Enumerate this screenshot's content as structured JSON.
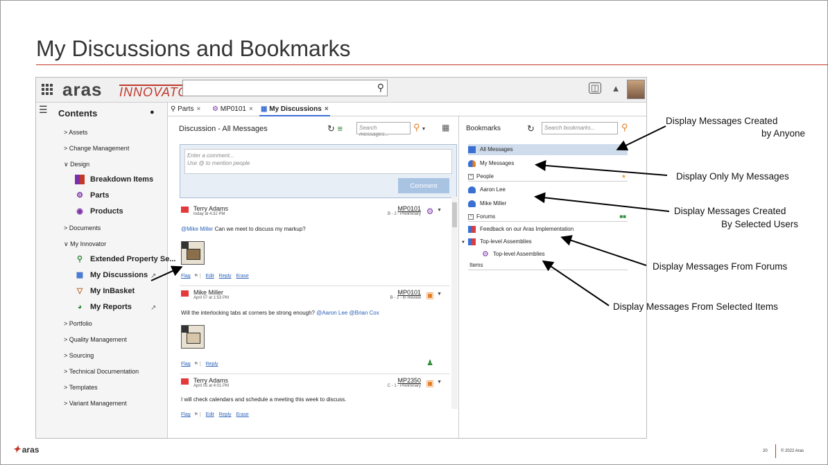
{
  "slide": {
    "title": "My Discussions and Bookmarks",
    "footer_brand": "aras",
    "page_number": "20",
    "copyright": "© 2022 Aras"
  },
  "app": {
    "logo_main": "aras",
    "logo_sub": "INNOVATOR",
    "tabs": [
      {
        "label": "Parts",
        "icon": "search-icon"
      },
      {
        "label": "MP0101",
        "icon": "gear-part-icon"
      },
      {
        "label": "My Discussions",
        "icon": "discussion-icon"
      }
    ],
    "close_glyph": "×"
  },
  "sidebar": {
    "title": "Contents",
    "items": [
      {
        "label": "> Assets"
      },
      {
        "label": "> Change Management"
      },
      {
        "label": "∨ Design"
      },
      {
        "label": "Breakdown Items",
        "icon": "breakdown-icon",
        "sub": true
      },
      {
        "label": "Parts",
        "icon": "parts-icon",
        "sub": true
      },
      {
        "label": "Products",
        "icon": "products-icon",
        "sub": true
      },
      {
        "label": "> Documents"
      },
      {
        "label": "∨ My Innovator"
      },
      {
        "label": "Extended Property Se...",
        "icon": "extended-property-icon",
        "sub": true
      },
      {
        "label": "My Discussions",
        "icon": "discussion-icon",
        "sub": true
      },
      {
        "label": "My InBasket",
        "icon": "inbasket-icon",
        "sub": true
      },
      {
        "label": "My Reports",
        "icon": "reports-icon",
        "sub": true
      },
      {
        "label": "> Portfolio"
      },
      {
        "label": "> Quality Management"
      },
      {
        "label": "> Sourcing"
      },
      {
        "label": "> Technical Documentation"
      },
      {
        "label": "> Templates"
      },
      {
        "label": "> Variant Management"
      }
    ]
  },
  "discussion": {
    "title": "Discussion - All Messages",
    "search_placeholder": "Search messages...",
    "comment_placeholder_1": "Enter a comment...",
    "comment_placeholder_2": "Use @ to mention people",
    "comment_button": "Comment",
    "messages": [
      {
        "author": "Terry Adams",
        "date": "today at 4:32 PM",
        "ref": "MP0101",
        "state": "B - 2 - Preliminary",
        "mention": "@Mike Miller",
        "text": " Can we meet to discuss my markup?",
        "actions": [
          "Flag",
          "Edit",
          "Reply",
          "Erase"
        ]
      },
      {
        "author": "Mike Miller",
        "date": "April 07 at 1:53 PM",
        "ref": "MP0101",
        "state": "B - 2 - In Review",
        "text": "Will the interlocking tabs at corners be strong enough? ",
        "mention": "@Aaron Lee @Brian Cox",
        "actions": [
          "Flag",
          "Reply"
        ]
      },
      {
        "author": "Terry Adams",
        "date": "April 05 at 4:01 PM",
        "ref": "MP2350",
        "state": "C - 1 - Preliminary",
        "text": "I will check calendars and schedule a meeting this week to discuss.",
        "actions": [
          "Flag",
          "Edit",
          "Reply",
          "Erase"
        ]
      }
    ]
  },
  "bookmarks": {
    "title": "Bookmarks",
    "search_placeholder": "Search bookmarks...",
    "all_messages": "All Messages",
    "my_messages": "My Messages",
    "people_group": "People",
    "people": [
      "Aaron Lee",
      "Mike Miller"
    ],
    "forums_group": "Forums",
    "forums": [
      "Feedback on our Aras Implementation",
      "Top-level Assemblies"
    ],
    "forum_child": "Top-level Assemblies",
    "items_group": "Items"
  },
  "callouts": {
    "anyone_1": "Display Messages Created",
    "anyone_2": "by Anyone",
    "only_mine": "Display Only My Messages",
    "selected_users_1": "Display Messages Created",
    "selected_users_2": "By Selected Users",
    "forums": "Display Messages From Forums",
    "items": "Display Messages From Selected Items"
  },
  "colors": {
    "accent_red": "#c0392b",
    "selection_blue": "#cfdcec",
    "link_blue": "#2a62b8"
  }
}
